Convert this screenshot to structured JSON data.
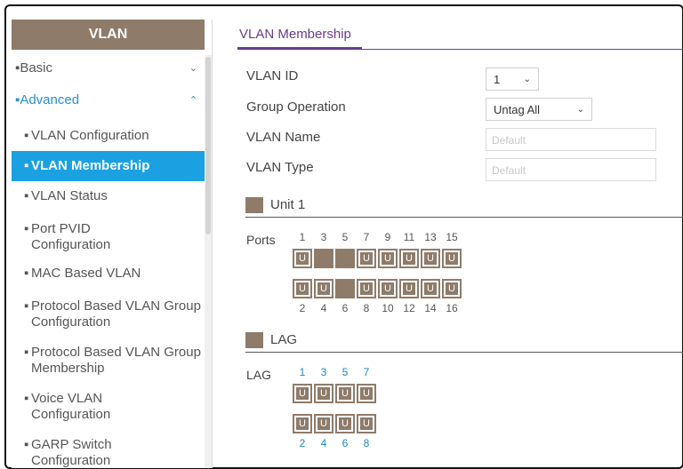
{
  "sidebar": {
    "title": "VLAN",
    "chevron_down": "⌄",
    "chevron_up": "⌃",
    "items": [
      {
        "label": "Basic",
        "level": "top",
        "expand": "down"
      },
      {
        "label": "Advanced",
        "level": "top",
        "expand": "up"
      },
      {
        "label": "VLAN Configuration",
        "level": "sub"
      },
      {
        "label": "VLAN Membership",
        "level": "sub",
        "active": true
      },
      {
        "label": "VLAN Status",
        "level": "sub"
      },
      {
        "label": "Port PVID Configuration",
        "level": "sub"
      },
      {
        "label": "MAC Based VLAN",
        "level": "sub"
      },
      {
        "label": "Protocol Based VLAN Group Configuration",
        "level": "sub"
      },
      {
        "label": "Protocol Based VLAN Group Membership",
        "level": "sub"
      },
      {
        "label": "Voice VLAN Configuration",
        "level": "sub"
      },
      {
        "label": "GARP Switch Configuration",
        "level": "sub"
      }
    ]
  },
  "tab": {
    "label": "VLAN Membership"
  },
  "form": {
    "vlan_id_label": "VLAN ID",
    "vlan_id_value": "1",
    "group_op_label": "Group Operation",
    "group_op_value": "Untag All",
    "vlan_name_label": "VLAN Name",
    "vlan_name_placeholder": "Default",
    "vlan_type_label": "VLAN Type",
    "vlan_type_placeholder": "Default"
  },
  "unit": {
    "title": "Unit 1",
    "row_label": "Ports",
    "top_numbers": [
      "1",
      "3",
      "5",
      "7",
      "9",
      "11",
      "13",
      "15"
    ],
    "bottom_numbers": [
      "2",
      "4",
      "6",
      "8",
      "10",
      "12",
      "14",
      "16"
    ],
    "top_states": [
      "U",
      "",
      "",
      "U",
      "U",
      "U",
      "U",
      "U"
    ],
    "bottom_states": [
      "U",
      "U",
      "",
      "U",
      "U",
      "U",
      "U",
      "U"
    ]
  },
  "lag": {
    "title": "LAG",
    "row_label": "LAG",
    "top_numbers": [
      "1",
      "3",
      "5",
      "7"
    ],
    "bottom_numbers": [
      "2",
      "4",
      "6",
      "8"
    ],
    "top_states": [
      "U",
      "U",
      "U",
      "U"
    ],
    "bottom_states": [
      "U",
      "U",
      "U",
      "U"
    ]
  },
  "colors": {
    "accent": "#1ba1e2",
    "brand": "#8e7b6a",
    "tab": "#6a3b8e",
    "link": "#1e88c7"
  }
}
